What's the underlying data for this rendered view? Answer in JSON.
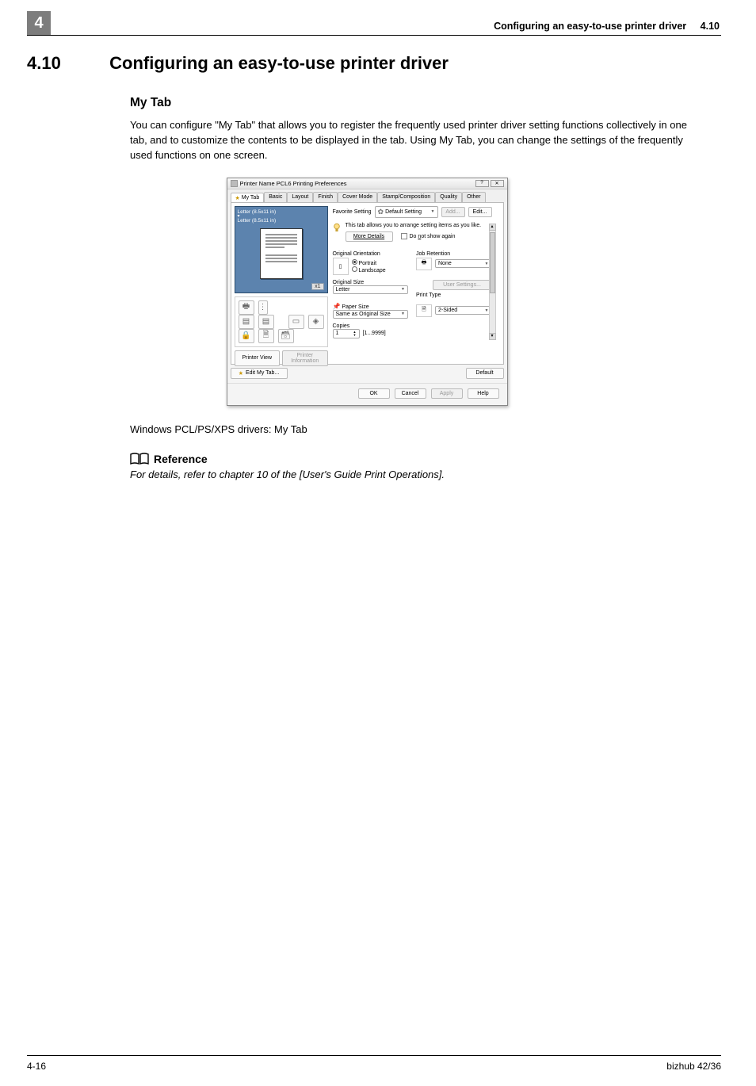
{
  "header": {
    "chapter_num": "4",
    "title": "Configuring an easy-to-use printer driver",
    "section_num": "4.10"
  },
  "h1": {
    "num": "4.10",
    "title": "Configuring an easy-to-use printer driver"
  },
  "h2": "My Tab",
  "para1": "You can configure \"My Tab\" that allows you to register the frequently used printer driver setting functions collectively in one tab, and to customize the contents to be displayed in the tab. Using My Tab, you can change the settings of the frequently used functions on one screen.",
  "dialog": {
    "title": "Printer Name PCL6 Printing Preferences",
    "tabs": [
      "My Tab",
      "Basic",
      "Layout",
      "Finish",
      "Cover Mode",
      "Stamp/Composition",
      "Quality",
      "Other"
    ],
    "preview": {
      "line1": "Letter (8.5x11 in)",
      "line2": "Letter (8.5x11 in)",
      "badge": "x1"
    },
    "printer_view": "Printer View",
    "printer_info": "Printer Information",
    "favorite_label": "Favorite Setting",
    "favorite_value": "Default Setting",
    "add_btn": "Add...",
    "edit_btn": "Edit...",
    "hint": "This tab allows you to arrange setting items as you like.",
    "more_details": "More Details",
    "dont_show": "Do not show again",
    "orig_orient_label": "Original Orientation",
    "portrait": "Portrait",
    "landscape": "Landscape",
    "job_retention_label": "Job Retention",
    "retention_value": "None",
    "user_settings_btn": "User Settings...",
    "orig_size_label": "Original Size",
    "orig_size_value": "Letter",
    "print_type_label": "Print Type",
    "print_type_value": "2-Sided",
    "paper_size_label": "Paper Size",
    "paper_size_value": "Same as Original Size",
    "copies_label": "Copies",
    "copies_value": "1",
    "copies_range": "[1...9999]",
    "edit_my_tab": "Edit My Tab...",
    "default_btn": "Default",
    "ok": "OK",
    "cancel": "Cancel",
    "apply": "Apply",
    "help": "Help"
  },
  "caption": "Windows PCL/PS/XPS drivers: My Tab",
  "reference_head": "Reference",
  "reference_text": "For details, refer to chapter 10 of the [User's Guide Print Operations].",
  "footer": {
    "left": "4-16",
    "right": "bizhub 42/36"
  }
}
